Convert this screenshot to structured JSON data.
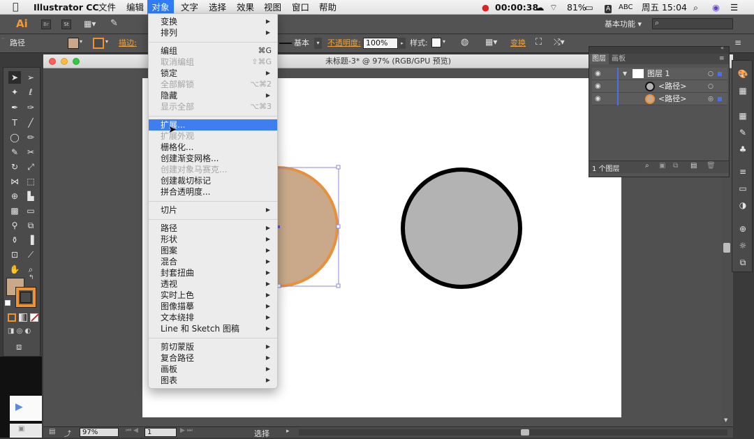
{
  "menubar": {
    "apple": "",
    "app_name": "Illustrator CC",
    "menus": [
      "文件",
      "编辑",
      "对象",
      "文字",
      "选择",
      "效果",
      "视图",
      "窗口",
      "帮助"
    ],
    "active_menu": "对象",
    "timer": "00:00:38",
    "battery": "81%",
    "input_method": "ABC",
    "clock": "周五 15:04"
  },
  "control_bar": {
    "logo": "Ai",
    "logo_small": "Br",
    "stock": "St",
    "workspace": "基本功能",
    "search_placeholder": ""
  },
  "property_bar": {
    "object_type": "路径",
    "stroke_label": "描边:",
    "brush_label": "基本",
    "opacity_label": "不透明度:",
    "opacity_value": "100%",
    "style_label": "样式:",
    "transform_label": "变换",
    "fill_color": "#c9a98a",
    "stroke_color": "#f0922e"
  },
  "document": {
    "title": "未标题-3* @ 97% (RGB/GPU 预览)",
    "zoom": "97%",
    "artboard_number": "1",
    "status_text": "选择"
  },
  "object_menu": {
    "items": [
      {
        "label": "变换",
        "shortcut": "",
        "submenu": true,
        "disabled": false
      },
      {
        "label": "排列",
        "shortcut": "",
        "submenu": true,
        "disabled": false
      },
      {
        "label": "编组",
        "shortcut": "⌘G",
        "submenu": false,
        "disabled": false
      },
      {
        "label": "取消编组",
        "shortcut": "⇧⌘G",
        "submenu": false,
        "disabled": true
      },
      {
        "label": "锁定",
        "shortcut": "",
        "submenu": true,
        "disabled": false
      },
      {
        "label": "全部解锁",
        "shortcut": "⌥⌘2",
        "submenu": false,
        "disabled": true
      },
      {
        "label": "隐藏",
        "shortcut": "",
        "submenu": true,
        "disabled": false
      },
      {
        "label": "显示全部",
        "shortcut": "⌥⌘3",
        "submenu": false,
        "disabled": true
      },
      {
        "label": "扩展...",
        "shortcut": "",
        "submenu": false,
        "disabled": false,
        "highlighted": true
      },
      {
        "label": "扩展外观",
        "shortcut": "",
        "submenu": false,
        "disabled": true
      },
      {
        "label": "栅格化...",
        "shortcut": "",
        "submenu": false,
        "disabled": false
      },
      {
        "label": "创建渐变网格...",
        "shortcut": "",
        "submenu": false,
        "disabled": false
      },
      {
        "label": "创建对象马赛克...",
        "shortcut": "",
        "submenu": false,
        "disabled": true
      },
      {
        "label": "创建裁切标记",
        "shortcut": "",
        "submenu": false,
        "disabled": false
      },
      {
        "label": "拼合透明度...",
        "shortcut": "",
        "submenu": false,
        "disabled": false
      },
      {
        "label": "切片",
        "shortcut": "",
        "submenu": true,
        "disabled": false
      },
      {
        "label": "路径",
        "shortcut": "",
        "submenu": true,
        "disabled": false
      },
      {
        "label": "形状",
        "shortcut": "",
        "submenu": true,
        "disabled": false
      },
      {
        "label": "图案",
        "shortcut": "",
        "submenu": true,
        "disabled": false
      },
      {
        "label": "混合",
        "shortcut": "",
        "submenu": true,
        "disabled": false
      },
      {
        "label": "封套扭曲",
        "shortcut": "",
        "submenu": true,
        "disabled": false
      },
      {
        "label": "透视",
        "shortcut": "",
        "submenu": true,
        "disabled": false
      },
      {
        "label": "实时上色",
        "shortcut": "",
        "submenu": true,
        "disabled": false
      },
      {
        "label": "图像描摹",
        "shortcut": "",
        "submenu": true,
        "disabled": false
      },
      {
        "label": "文本绕排",
        "shortcut": "",
        "submenu": true,
        "disabled": false
      },
      {
        "label": "Line 和 Sketch 图稿",
        "shortcut": "",
        "submenu": true,
        "disabled": false
      },
      {
        "label": "剪切蒙版",
        "shortcut": "",
        "submenu": true,
        "disabled": false
      },
      {
        "label": "复合路径",
        "shortcut": "",
        "submenu": true,
        "disabled": false
      },
      {
        "label": "画板",
        "shortcut": "",
        "submenu": true,
        "disabled": false
      },
      {
        "label": "图表",
        "shortcut": "",
        "submenu": true,
        "disabled": false
      }
    ]
  },
  "layers_panel": {
    "tabs": [
      "图层",
      "画板"
    ],
    "layer_name": "图层 1",
    "sublayers": [
      "<路径>",
      "<路径>"
    ],
    "footer": "1 个图层"
  },
  "colors": {
    "accent": "#3d7ff0",
    "orange": "#f0922e",
    "selection": "#6f6fd8"
  }
}
